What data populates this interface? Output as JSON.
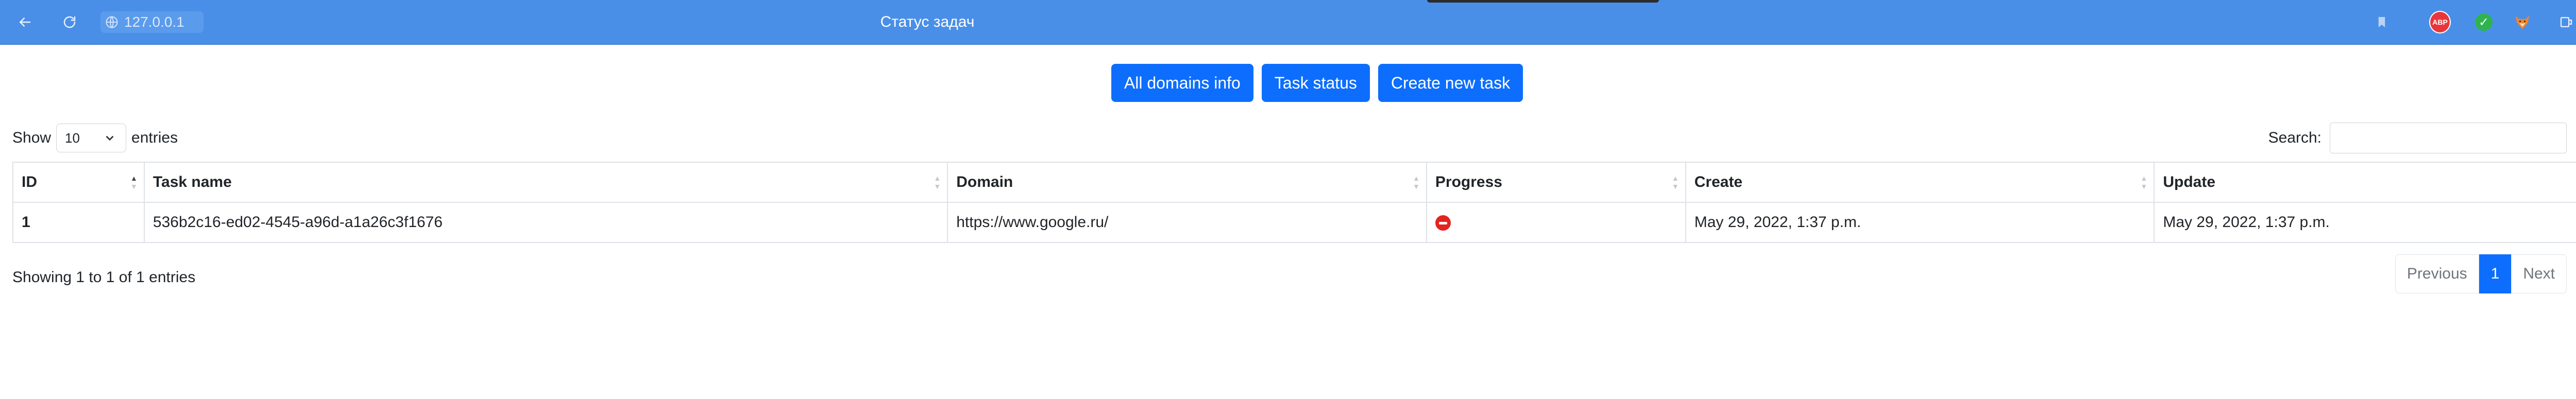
{
  "browser": {
    "url": "127.0.0.1",
    "tab_title": "Статус задач",
    "extensions": {
      "adblock_label": "ABP"
    },
    "colors": {
      "toolbar": "#4a8fe7"
    }
  },
  "nav": {
    "buttons": [
      {
        "label": "All domains info"
      },
      {
        "label": "Task status"
      },
      {
        "label": "Create new task"
      }
    ],
    "accent": "#0d6efd"
  },
  "controls": {
    "show_label": "Show",
    "entries_value": "10",
    "entries_label": "entries",
    "search_label": "Search:",
    "search_value": ""
  },
  "table": {
    "columns": [
      "ID",
      "Task name",
      "Domain",
      "Progress",
      "Create",
      "Update"
    ],
    "rows": [
      {
        "id": "1",
        "task_name": "536b2c16-ed02-4545-a96d-a1a26c3f1676",
        "domain": "https://www.google.ru/",
        "progress_icon": "error-stop-icon",
        "create": "May 29, 2022, 1:37 p.m.",
        "update": "May 29, 2022, 1:37 p.m."
      }
    ]
  },
  "footer": {
    "info": "Showing 1 to 1 of 1 entries",
    "previous": "Previous",
    "page": "1",
    "next": "Next"
  }
}
